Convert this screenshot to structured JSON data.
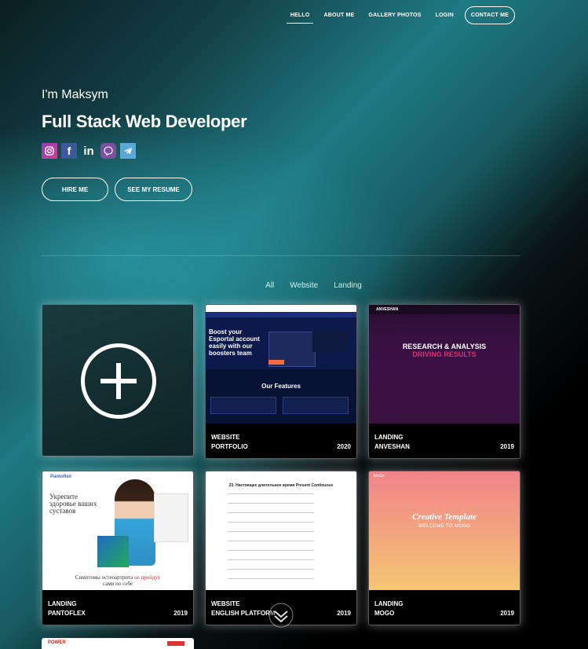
{
  "nav": {
    "items": [
      "HELLO",
      "ABOUT ME",
      "GALLERY PHOTOS",
      "LOGIN"
    ],
    "contact": "CONTACT ME",
    "active": "HELLO"
  },
  "hero": {
    "greeting": "I'm Maksym",
    "role": "Full Stack Web Developer",
    "socials": [
      "instagram-icon",
      "facebook-icon",
      "linkedin-icon",
      "viber-icon",
      "telegram-icon"
    ],
    "hire_label": "HIRE ME",
    "resume_label": "SEE MY RESUME"
  },
  "filters": [
    "All",
    "Website",
    "Landing"
  ],
  "portfolio": [
    {
      "category": "WEBSITE",
      "name": "PORTFOLIO",
      "year": "2020",
      "thumb": {
        "headline": "Boost your Esportal account easily with our boosters team",
        "section": "Our Features"
      }
    },
    {
      "category": "LANDING",
      "name": "ANVESHAN",
      "year": "2019",
      "thumb": {
        "logo": "ANVESHAN",
        "line1": "RESEARCH & ANALYSIS",
        "line2": "DRIVING RESULTS"
      }
    },
    {
      "category": "LANDING",
      "name": "PANTOFLEX",
      "year": "2019",
      "thumb": {
        "logo": "Pantoflex",
        "headline": "Укрепите здоровье ваших суставов",
        "bottom": "Симптомы остеоартрита",
        "bottom_red": "не пройдут",
        "bottom_end": "сами по себе"
      }
    },
    {
      "category": "WEBSITE",
      "name": "ENGLISH PLATFORM",
      "year": "2019",
      "thumb": {
        "headline": "23. Настоящее длительное время Present Continuous"
      }
    },
    {
      "category": "LANDING",
      "name": "MOGO",
      "year": "2019",
      "thumb": {
        "logo": "MoGo",
        "line1": "Creative Template",
        "line2": "WELCOME TO MOGO"
      }
    }
  ],
  "partial_card": {
    "logo": "POWER"
  },
  "colors": {
    "accent": "#1f7a83",
    "background": "#000000"
  }
}
